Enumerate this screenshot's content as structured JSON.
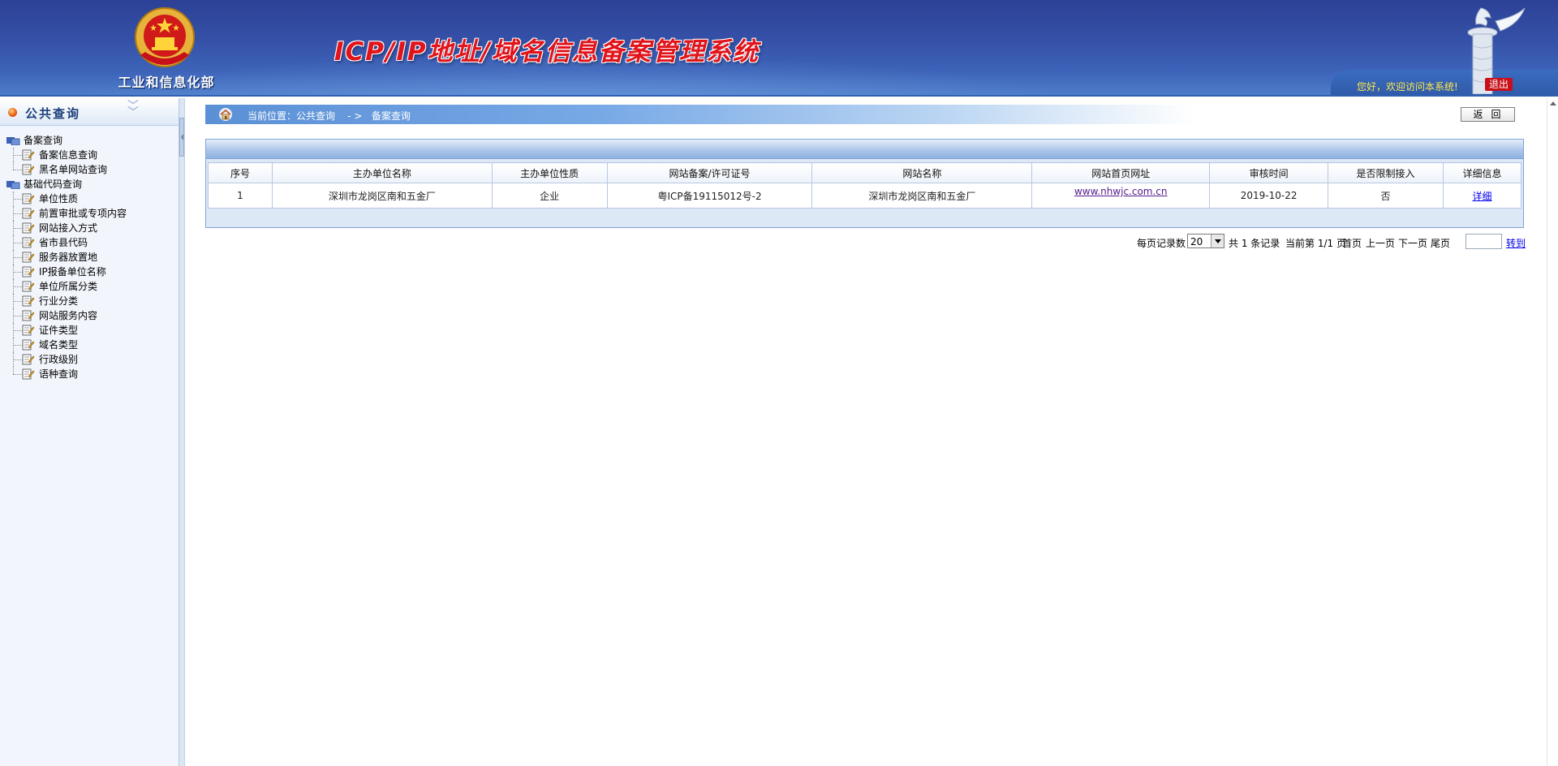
{
  "header": {
    "ministry": "工业和信息化部",
    "title": "ICP/IP地址/域名信息备案管理系统",
    "welcome": "您好，欢迎访问本系统!",
    "logout_label": "退出"
  },
  "sidebar": {
    "title": "公共查询",
    "groups": [
      {
        "label": "备案查询",
        "items": [
          "备案信息查询",
          "黑名单网站查询"
        ]
      },
      {
        "label": "基础代码查询",
        "items": [
          "单位性质",
          "前置审批或专项内容",
          "网站接入方式",
          "省市县代码",
          "服务器放置地",
          "IP报备单位名称",
          "单位所属分类",
          "行业分类",
          "网站服务内容",
          "证件类型",
          "域名类型",
          "行政级别",
          "语种查询"
        ]
      }
    ]
  },
  "breadcrumb": {
    "text": "当前位置：公共查询    - >   备案查询"
  },
  "back_label": "返回",
  "table": {
    "headers": [
      "序号",
      "主办单位名称",
      "主办单位性质",
      "网站备案/许可证号",
      "网站名称",
      "网站首页网址",
      "审核时间",
      "是否限制接入",
      "详细信息"
    ],
    "rows": [
      {
        "no": "1",
        "org_name": "深圳市龙岗区南和五金厂",
        "org_type": "企业",
        "license": "粤ICP备19115012号-2",
        "site_name": "深圳市龙岗区南和五金厂",
        "url": "www.nhwjc.com.cn",
        "audit_date": "2019-10-22",
        "restricted": "否",
        "detail": "详细"
      }
    ]
  },
  "pager": {
    "per_page_label": "每页记录数",
    "per_page": "20",
    "total": "共 1 条记录",
    "current": "当前第 1/1 页",
    "first": "首页",
    "prev": "上一页",
    "next": "下一页",
    "last": "尾页",
    "goto": "转到"
  },
  "colors": {
    "header_blue": "#3450a6",
    "title_red": "#e1141b",
    "welcome_yellow": "#ffe84a",
    "logout_red": "#c8101a",
    "link_purple": "#551a8b"
  }
}
